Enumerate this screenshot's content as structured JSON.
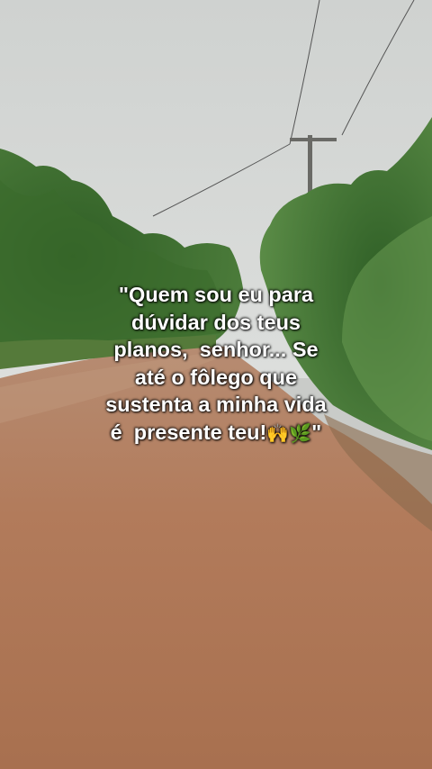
{
  "quote": {
    "lines": [
      "\"Quem sou eu para",
      "dúvidar dos teus",
      "planos,  senhor... Se",
      "até o fôlego que",
      "sustenta a minha vida"
    ],
    "last_line_text": "é  presente teu!",
    "emojis": [
      "🙌",
      "🌿"
    ],
    "closing_quote": "\""
  },
  "colors": {
    "sky": "#d3d5d3",
    "road": "#b07a5a",
    "foliage": "#3f6f2f",
    "text": "#ffffff"
  }
}
